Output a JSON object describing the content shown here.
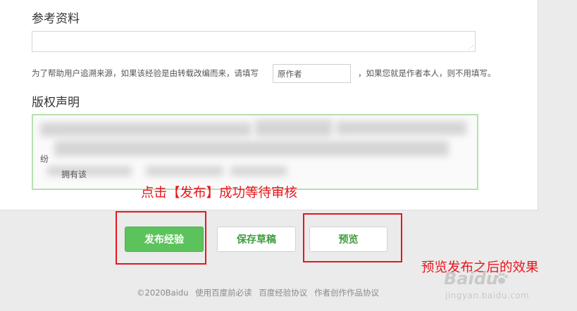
{
  "reference": {
    "title": "参考资料",
    "hint_before": "为了帮助用户追溯来源，如果该经验是由转载改编而来，请填写",
    "author_placeholder": "原作者",
    "hint_after": "，如果您就是作者本人，则不用填写。"
  },
  "copyright": {
    "title": "版权声明",
    "visible_fragments": [
      "纷",
      "拥有该"
    ]
  },
  "annotations": {
    "publish": "点击【发布】成功等待审核",
    "preview": "预览发布之后的效果"
  },
  "buttons": {
    "publish": "发布经验",
    "save": "保存草稿",
    "preview": "预览"
  },
  "footer": {
    "copyright": "©2020Baidu",
    "link1": "使用百度前必读",
    "link2": "百度经验协议",
    "link3": "作者创作作品协议"
  },
  "watermark": {
    "logo": "Baidu",
    "sub": "jingyan.baidu.com"
  },
  "colors": {
    "accent_green": "#5cc35c",
    "annotation_red": "#e8161e"
  }
}
